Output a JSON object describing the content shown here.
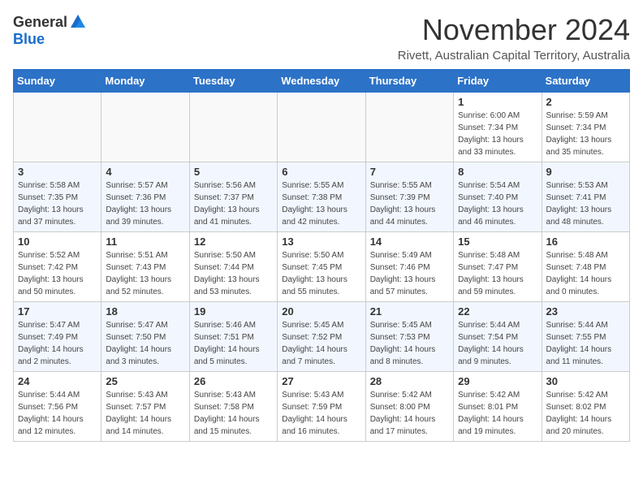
{
  "logo": {
    "general": "General",
    "blue": "Blue"
  },
  "header": {
    "month": "November 2024",
    "location": "Rivett, Australian Capital Territory, Australia"
  },
  "weekdays": [
    "Sunday",
    "Monday",
    "Tuesday",
    "Wednesday",
    "Thursday",
    "Friday",
    "Saturday"
  ],
  "weeks": [
    [
      {
        "day": "",
        "info": ""
      },
      {
        "day": "",
        "info": ""
      },
      {
        "day": "",
        "info": ""
      },
      {
        "day": "",
        "info": ""
      },
      {
        "day": "",
        "info": ""
      },
      {
        "day": "1",
        "info": "Sunrise: 6:00 AM\nSunset: 7:34 PM\nDaylight: 13 hours\nand 33 minutes."
      },
      {
        "day": "2",
        "info": "Sunrise: 5:59 AM\nSunset: 7:34 PM\nDaylight: 13 hours\nand 35 minutes."
      }
    ],
    [
      {
        "day": "3",
        "info": "Sunrise: 5:58 AM\nSunset: 7:35 PM\nDaylight: 13 hours\nand 37 minutes."
      },
      {
        "day": "4",
        "info": "Sunrise: 5:57 AM\nSunset: 7:36 PM\nDaylight: 13 hours\nand 39 minutes."
      },
      {
        "day": "5",
        "info": "Sunrise: 5:56 AM\nSunset: 7:37 PM\nDaylight: 13 hours\nand 41 minutes."
      },
      {
        "day": "6",
        "info": "Sunrise: 5:55 AM\nSunset: 7:38 PM\nDaylight: 13 hours\nand 42 minutes."
      },
      {
        "day": "7",
        "info": "Sunrise: 5:55 AM\nSunset: 7:39 PM\nDaylight: 13 hours\nand 44 minutes."
      },
      {
        "day": "8",
        "info": "Sunrise: 5:54 AM\nSunset: 7:40 PM\nDaylight: 13 hours\nand 46 minutes."
      },
      {
        "day": "9",
        "info": "Sunrise: 5:53 AM\nSunset: 7:41 PM\nDaylight: 13 hours\nand 48 minutes."
      }
    ],
    [
      {
        "day": "10",
        "info": "Sunrise: 5:52 AM\nSunset: 7:42 PM\nDaylight: 13 hours\nand 50 minutes."
      },
      {
        "day": "11",
        "info": "Sunrise: 5:51 AM\nSunset: 7:43 PM\nDaylight: 13 hours\nand 52 minutes."
      },
      {
        "day": "12",
        "info": "Sunrise: 5:50 AM\nSunset: 7:44 PM\nDaylight: 13 hours\nand 53 minutes."
      },
      {
        "day": "13",
        "info": "Sunrise: 5:50 AM\nSunset: 7:45 PM\nDaylight: 13 hours\nand 55 minutes."
      },
      {
        "day": "14",
        "info": "Sunrise: 5:49 AM\nSunset: 7:46 PM\nDaylight: 13 hours\nand 57 minutes."
      },
      {
        "day": "15",
        "info": "Sunrise: 5:48 AM\nSunset: 7:47 PM\nDaylight: 13 hours\nand 59 minutes."
      },
      {
        "day": "16",
        "info": "Sunrise: 5:48 AM\nSunset: 7:48 PM\nDaylight: 14 hours\nand 0 minutes."
      }
    ],
    [
      {
        "day": "17",
        "info": "Sunrise: 5:47 AM\nSunset: 7:49 PM\nDaylight: 14 hours\nand 2 minutes."
      },
      {
        "day": "18",
        "info": "Sunrise: 5:47 AM\nSunset: 7:50 PM\nDaylight: 14 hours\nand 3 minutes."
      },
      {
        "day": "19",
        "info": "Sunrise: 5:46 AM\nSunset: 7:51 PM\nDaylight: 14 hours\nand 5 minutes."
      },
      {
        "day": "20",
        "info": "Sunrise: 5:45 AM\nSunset: 7:52 PM\nDaylight: 14 hours\nand 7 minutes."
      },
      {
        "day": "21",
        "info": "Sunrise: 5:45 AM\nSunset: 7:53 PM\nDaylight: 14 hours\nand 8 minutes."
      },
      {
        "day": "22",
        "info": "Sunrise: 5:44 AM\nSunset: 7:54 PM\nDaylight: 14 hours\nand 9 minutes."
      },
      {
        "day": "23",
        "info": "Sunrise: 5:44 AM\nSunset: 7:55 PM\nDaylight: 14 hours\nand 11 minutes."
      }
    ],
    [
      {
        "day": "24",
        "info": "Sunrise: 5:44 AM\nSunset: 7:56 PM\nDaylight: 14 hours\nand 12 minutes."
      },
      {
        "day": "25",
        "info": "Sunrise: 5:43 AM\nSunset: 7:57 PM\nDaylight: 14 hours\nand 14 minutes."
      },
      {
        "day": "26",
        "info": "Sunrise: 5:43 AM\nSunset: 7:58 PM\nDaylight: 14 hours\nand 15 minutes."
      },
      {
        "day": "27",
        "info": "Sunrise: 5:43 AM\nSunset: 7:59 PM\nDaylight: 14 hours\nand 16 minutes."
      },
      {
        "day": "28",
        "info": "Sunrise: 5:42 AM\nSunset: 8:00 PM\nDaylight: 14 hours\nand 17 minutes."
      },
      {
        "day": "29",
        "info": "Sunrise: 5:42 AM\nSunset: 8:01 PM\nDaylight: 14 hours\nand 19 minutes."
      },
      {
        "day": "30",
        "info": "Sunrise: 5:42 AM\nSunset: 8:02 PM\nDaylight: 14 hours\nand 20 minutes."
      }
    ]
  ]
}
